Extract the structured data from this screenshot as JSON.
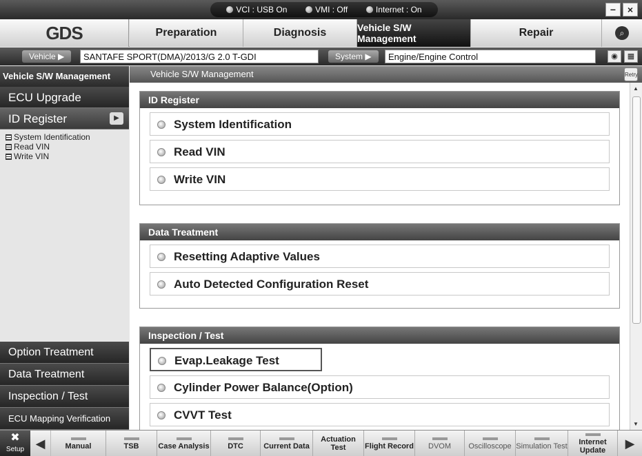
{
  "titlebar": {
    "status": [
      {
        "label": "VCI : USB On"
      },
      {
        "label": "VMI : Off"
      },
      {
        "label": "Internet : On"
      }
    ],
    "minimize": "−",
    "close": "×"
  },
  "nav": {
    "logo": "GDS",
    "tabs": [
      "Preparation",
      "Diagnosis",
      "Vehicle S/W Management",
      "Repair"
    ],
    "active_tab": "Vehicle S/W Management"
  },
  "vehicle_bar": {
    "vehicle_label": "Vehicle",
    "vehicle_value": "SANTAFE SPORT(DMA)/2013/G 2.0 T-GDI",
    "system_label": "System",
    "system_value": "Engine/Engine Control"
  },
  "sidebar": {
    "header": "Vehicle S/W Management",
    "items": [
      "ECU Upgrade",
      "ID Register"
    ],
    "sub_items": [
      "System Identification",
      "Read VIN",
      "Write VIN"
    ],
    "bottom_items": [
      "Option Treatment",
      "Data Treatment",
      "Inspection / Test",
      "ECU Mapping Verification"
    ]
  },
  "main": {
    "header": "Vehicle S/W Management",
    "retry": "Retry",
    "groups": [
      {
        "title": "ID Register",
        "options": [
          "System Identification",
          "Read VIN",
          "Write VIN"
        ]
      },
      {
        "title": "Data Treatment",
        "options": [
          "Resetting Adaptive Values",
          "Auto Detected Configuration Reset"
        ]
      },
      {
        "title": "Inspection / Test",
        "options": [
          "Evap.Leakage Test",
          "Cylinder Power Balance(Option)",
          "CVVT Test"
        ]
      }
    ]
  },
  "toolbar": {
    "setup": "Setup",
    "buttons": [
      "Manual",
      "TSB",
      "Case Analysis",
      "DTC",
      "Current Data",
      "Actuation Test",
      "Flight Record",
      "DVOM",
      "Oscilloscope",
      "Simulation Test",
      "Internet Update"
    ]
  }
}
